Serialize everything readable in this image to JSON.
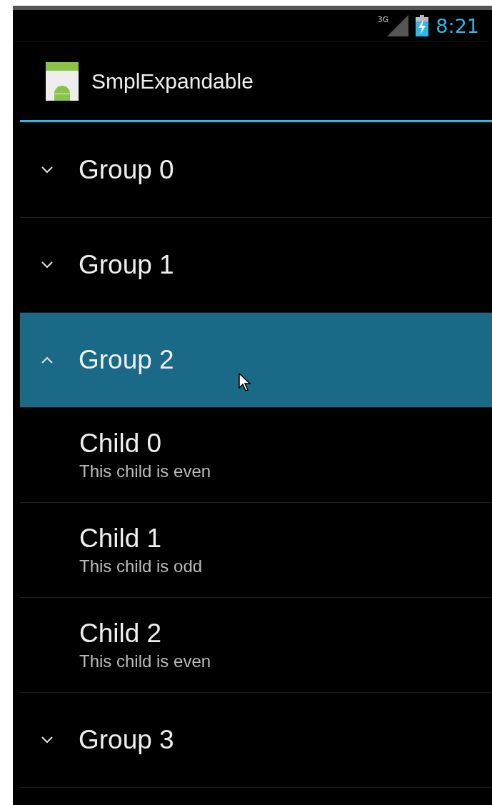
{
  "status_bar": {
    "network": "3G",
    "time": "8:21"
  },
  "action_bar": {
    "title": "SmplExpandable"
  },
  "groups": [
    {
      "title": "Group 0",
      "expanded": false,
      "selected": false
    },
    {
      "title": "Group 1",
      "expanded": false,
      "selected": false
    },
    {
      "title": "Group 2",
      "expanded": true,
      "selected": true,
      "children": [
        {
          "title": "Child 0",
          "subtitle": "This child is even"
        },
        {
          "title": "Child 1",
          "subtitle": "This child is odd"
        },
        {
          "title": "Child 2",
          "subtitle": "This child is even"
        }
      ]
    },
    {
      "title": "Group 3",
      "expanded": false,
      "selected": false
    }
  ]
}
